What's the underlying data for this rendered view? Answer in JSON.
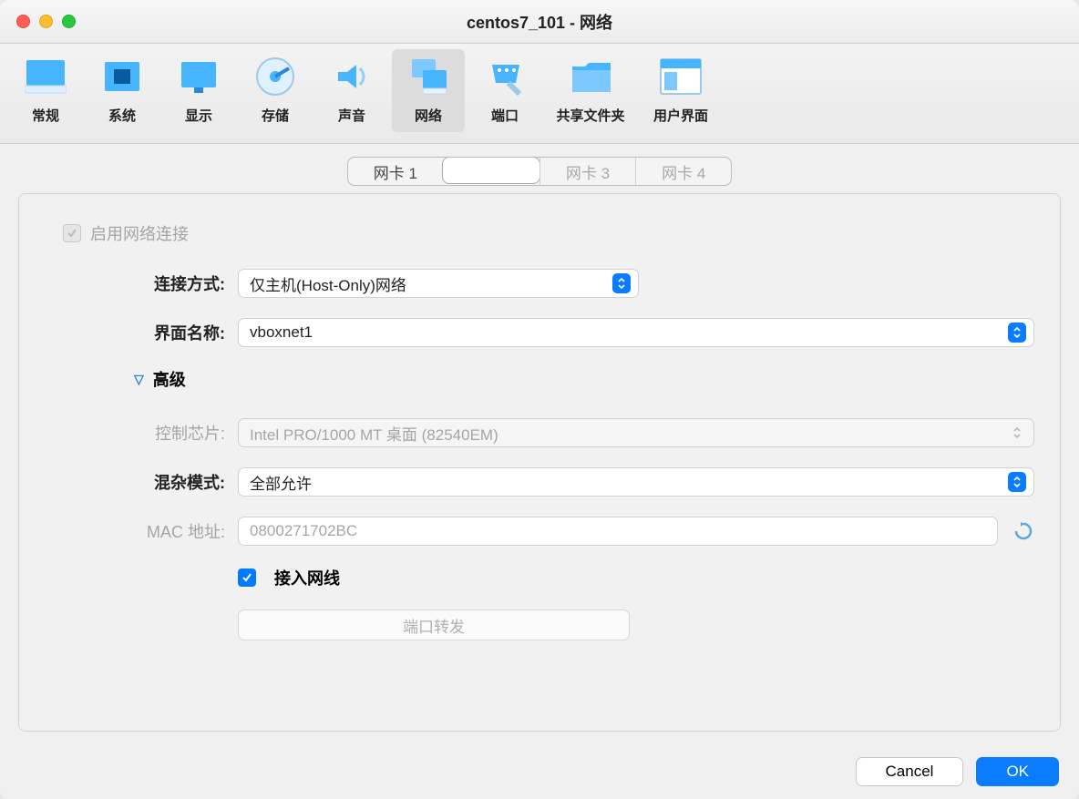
{
  "window": {
    "title": "centos7_101 - 网络"
  },
  "toolbar": [
    {
      "label": "常规"
    },
    {
      "label": "系统"
    },
    {
      "label": "显示"
    },
    {
      "label": "存储"
    },
    {
      "label": "声音"
    },
    {
      "label": "网络"
    },
    {
      "label": "端口"
    },
    {
      "label": "共享文件夹"
    },
    {
      "label": "用户界面"
    }
  ],
  "tabs": [
    {
      "label": "网卡 1"
    },
    {
      "label": ""
    },
    {
      "label": "网卡 3"
    },
    {
      "label": "网卡 4"
    }
  ],
  "form": {
    "enable_label": "启用网络连接",
    "attach_label": "连接方式:",
    "attach_value": "仅主机(Host-Only)网络",
    "iface_label": "界面名称:",
    "iface_value": "vboxnet1",
    "advanced_label": "高级",
    "chip_label": "控制芯片:",
    "chip_value": "Intel PRO/1000 MT 桌面 (82540EM)",
    "promisc_label": "混杂模式:",
    "promisc_value": "全部允许",
    "mac_label": "MAC 地址:",
    "mac_value": "0800271702BC",
    "cable_label": "接入网线",
    "portfwd_label": "端口转发"
  },
  "footer": {
    "cancel": "Cancel",
    "ok": "OK"
  }
}
